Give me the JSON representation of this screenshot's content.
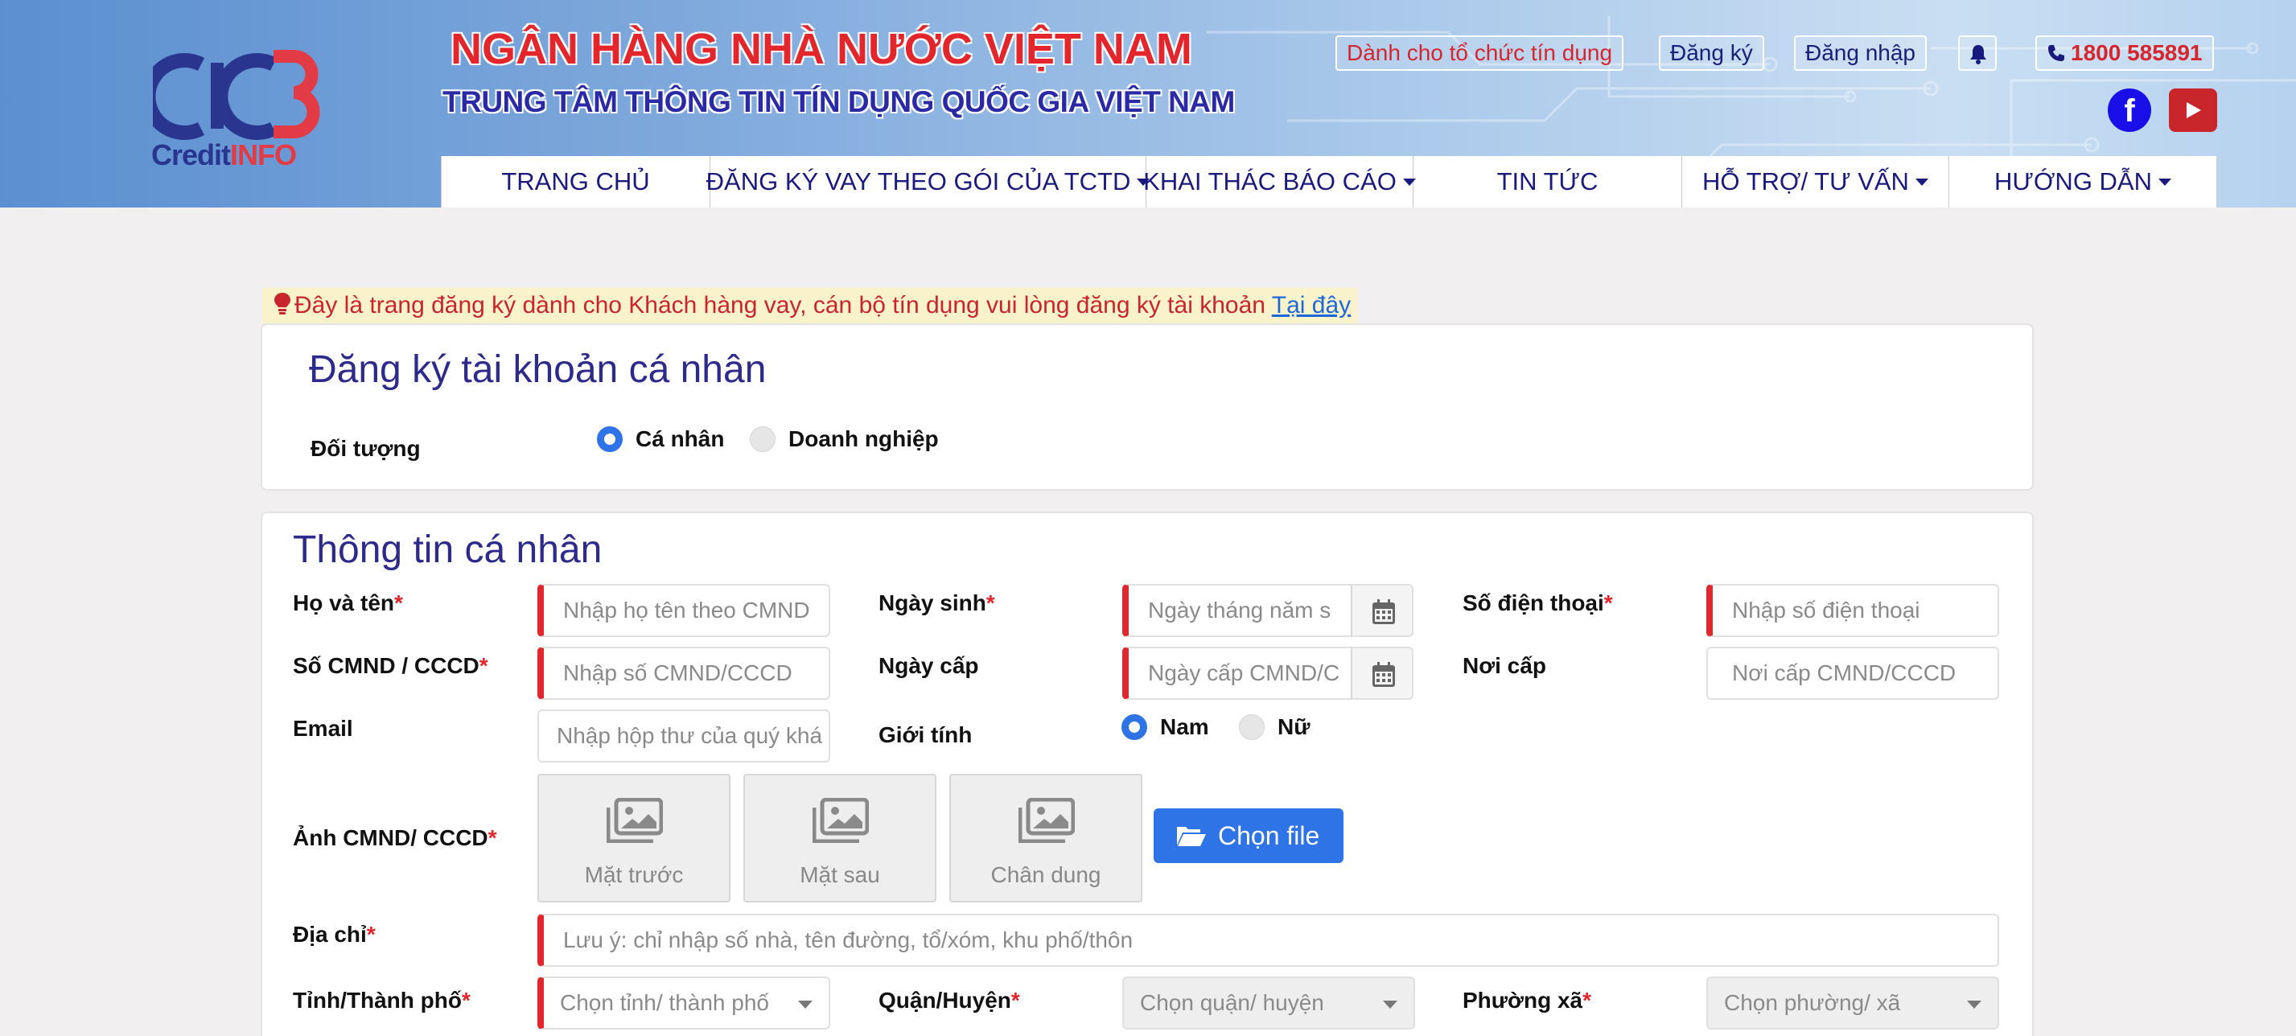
{
  "header": {
    "logo_text": "CreditINFO",
    "logo_text_a": "Credit",
    "logo_text_b": "INFO",
    "title_main": "NGÂN HÀNG NHÀ NƯỚC VIỆT NAM",
    "title_sub": "TRUNG TÂM THÔNG TIN TÍN DỤNG QUỐC GIA VIỆT NAM",
    "org_link": "Dành cho tổ chức tín dụng",
    "register": "Đăng ký",
    "login": "Đăng nhập",
    "hotline": "1800 585891",
    "facebook_letter": "f"
  },
  "nav": {
    "items": [
      "TRANG CHỦ",
      "ĐĂNG KÝ VAY THEO GÓI CỦA TCTD",
      "KHAI THÁC BÁO CÁO",
      "TIN TỨC",
      "HỖ TRỢ/ TƯ VẤN",
      "HƯỚNG DẪN"
    ]
  },
  "notice": {
    "text": "Đây là trang đăng ký dành cho Khách hàng vay, cán bộ tín dụng vui lòng đăng ký tài khoản ",
    "link": "Tại đây"
  },
  "account": {
    "title": "Đăng ký tài khoản cá nhân",
    "subject_label": "Đối tượng",
    "options": [
      "Cá nhân",
      "Doanh nghiệp"
    ]
  },
  "personal": {
    "title": "Thông tin cá nhân",
    "fullname_label": "Họ và tên",
    "fullname_placeholder": "Nhập họ tên theo CMND",
    "dob_label": "Ngày sinh",
    "dob_placeholder": "Ngày tháng năm s",
    "phone_label": "Số điện thoại",
    "phone_placeholder": "Nhập số điện thoại",
    "idno_label": "Số CMND / CCCD",
    "idno_placeholder": "Nhập số CMND/CCCD",
    "issue_date_label": "Ngày cấp",
    "issue_date_placeholder": "Ngày cấp CMND/C",
    "issue_place_label": "Nơi cấp",
    "issue_place_placeholder": "Nơi cấp CMND/CCCD",
    "email_label": "Email",
    "email_placeholder": "Nhập hộp thư của quý khá",
    "gender_label": "Giới tính",
    "gender_options": [
      "Nam",
      "Nữ"
    ],
    "photo_label": "Ảnh CMND/ CCCD",
    "photos": [
      "Mặt trước",
      "Mặt sau",
      "Chân dung"
    ],
    "choose_file": "Chọn file",
    "address_label": "Địa chỉ",
    "address_placeholder": "Lưu ý: chỉ nhập số nhà, tên đường, tổ/xóm, khu phố/thôn",
    "province_label": "Tỉnh/Thành phố",
    "province_placeholder": "Chọn tỉnh/ thành phố",
    "district_label": "Quận/Huyện",
    "district_placeholder": "Chọn quận/ huyện",
    "ward_label": "Phường xã",
    "ward_placeholder": "Chọn phường/ xã",
    "required_mark": "*"
  }
}
